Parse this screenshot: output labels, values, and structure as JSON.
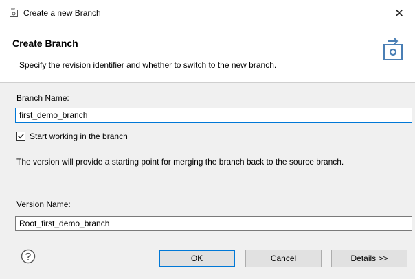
{
  "window": {
    "title": "Create a new Branch",
    "close_glyph": "✕"
  },
  "banner": {
    "title": "Create Branch",
    "description": "Specify the revision identifier and whether to switch to the new branch.",
    "icon": "branch-wizard-icon"
  },
  "form": {
    "branch_name_label": "Branch Name:",
    "branch_name_value": "first_demo_branch",
    "start_working_label": "Start working in the branch",
    "start_working_checked": true,
    "info_text": "The version will provide a starting point for merging the branch back to the source branch.",
    "version_name_label": "Version Name:",
    "version_name_value": "Root_first_demo_branch"
  },
  "buttons": {
    "ok": "OK",
    "cancel": "Cancel",
    "details": "Details >>"
  },
  "colors": {
    "accent": "#0078d7",
    "banner_icon": "#4a7fb5"
  }
}
